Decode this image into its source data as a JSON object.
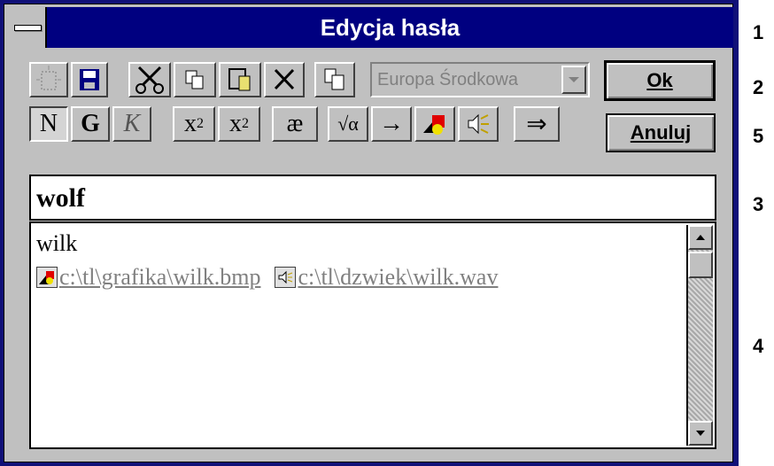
{
  "window": {
    "title": "Edycja hasła"
  },
  "toolbar": {
    "combo_value": "Europa Środkowa",
    "bold": "N",
    "bold2": "G",
    "italic": "K",
    "sup": "x",
    "sup_exp": "2",
    "sub": "x",
    "sub_idx": "2",
    "ae": "æ",
    "root": "√α",
    "arrow": "→",
    "double_arrow": "⇒"
  },
  "buttons": {
    "ok": "Ok",
    "cancel": "Anuluj"
  },
  "entry": {
    "headword": "wolf",
    "translation": "wilk",
    "image_link": "c:\\tl\\grafika\\wilk.bmp",
    "sound_link": "c:\\tl\\dzwiek\\wilk.wav"
  },
  "callouts": [
    "1",
    "2",
    "5",
    "3",
    "4"
  ]
}
